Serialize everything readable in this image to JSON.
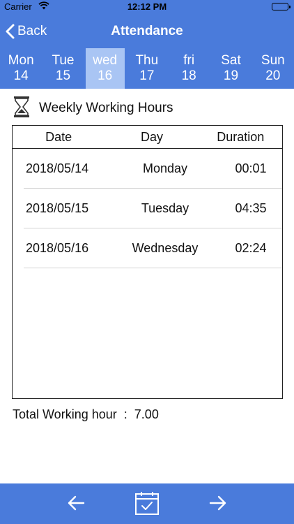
{
  "status_bar": {
    "carrier": "Carrier",
    "time": "12:12 PM"
  },
  "nav": {
    "back_label": "Back",
    "title": "Attendance"
  },
  "week": [
    {
      "day": "Mon",
      "date": "14"
    },
    {
      "day": "Tue",
      "date": "15"
    },
    {
      "day": "wed",
      "date": "16"
    },
    {
      "day": "Thu",
      "date": "17"
    },
    {
      "day": "fri",
      "date": "18"
    },
    {
      "day": "Sat",
      "date": "19"
    },
    {
      "day": "Sun",
      "date": "20"
    }
  ],
  "selected_day_index": 2,
  "section": {
    "title": "Weekly Working Hours",
    "icon": "hourglass-icon"
  },
  "table": {
    "headers": [
      "Date",
      "Day",
      "Duration"
    ],
    "rows": [
      {
        "date": "2018/05/14",
        "day": "Monday",
        "duration": "00:01"
      },
      {
        "date": "2018/05/15",
        "day": "Tuesday",
        "duration": "04:35"
      },
      {
        "date": "2018/05/16",
        "day": "Wednesday",
        "duration": "02:24"
      }
    ]
  },
  "total": {
    "label": "Total Working hour",
    "separator": ":",
    "value": "7.00"
  },
  "toolbar": {
    "prev_icon": "arrow-left-icon",
    "calendar_icon": "calendar-check-icon",
    "next_icon": "arrow-right-icon"
  },
  "colors": {
    "primary": "#4a7bdb",
    "selected_day": "#a9c5f4"
  }
}
